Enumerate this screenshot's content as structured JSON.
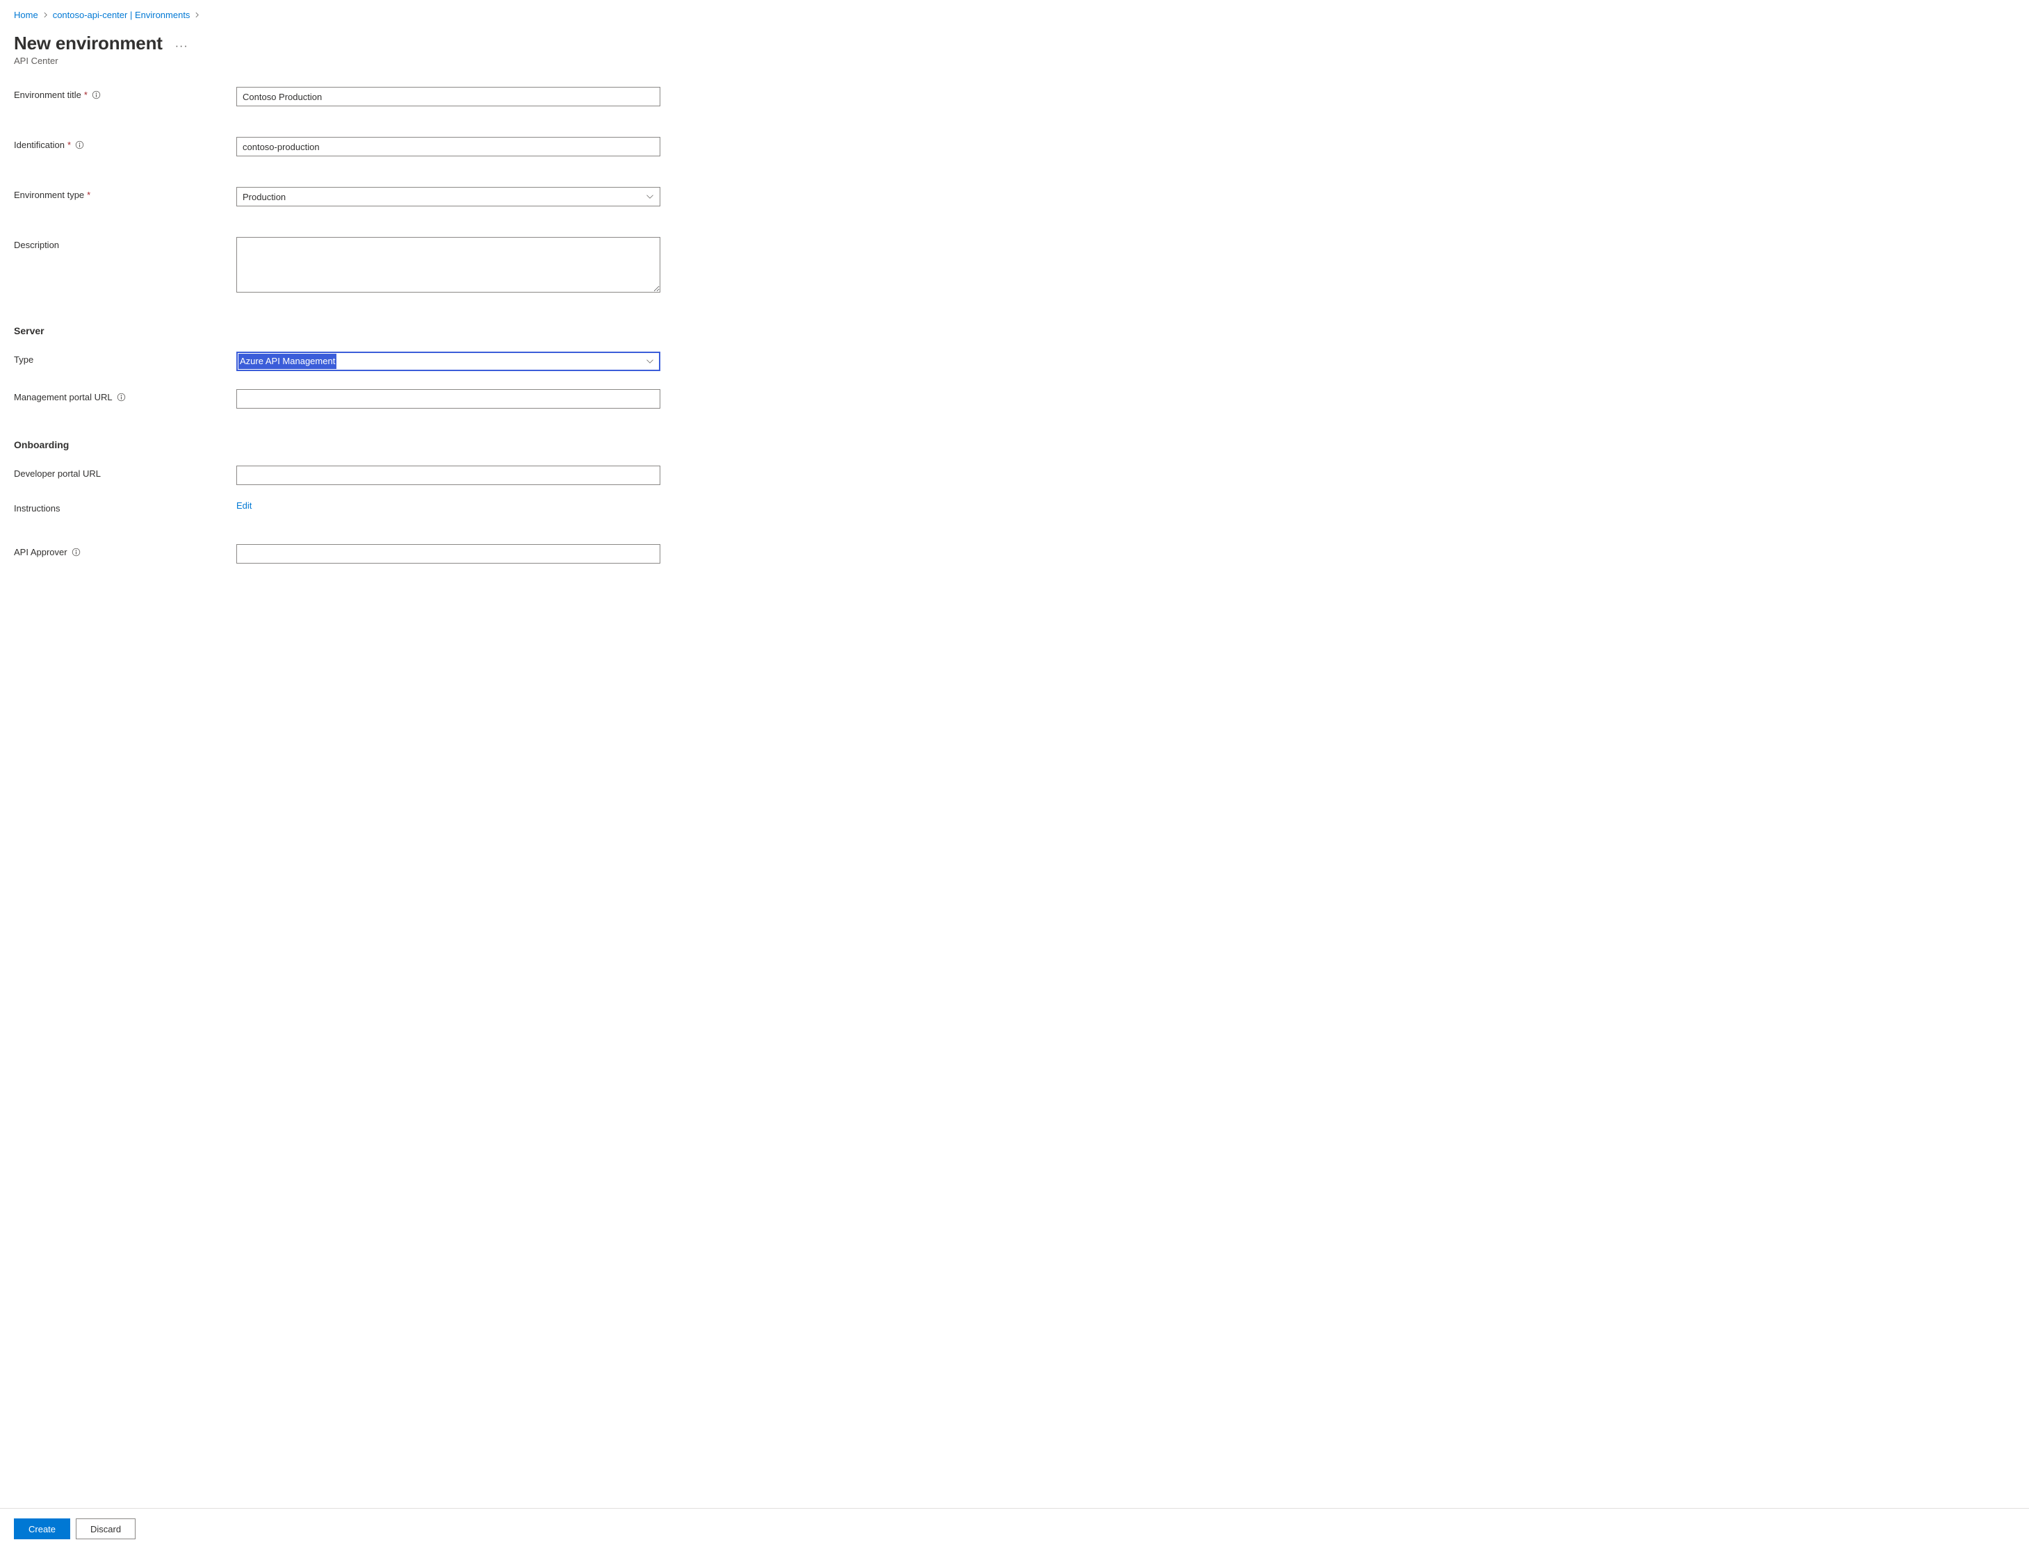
{
  "breadcrumb": {
    "home": "Home",
    "resource": "contoso-api-center | Environments"
  },
  "header": {
    "title": "New environment",
    "subtitle": "API Center"
  },
  "fields": {
    "env_title": {
      "label": "Environment title",
      "value": "Contoso Production"
    },
    "identification": {
      "label": "Identification",
      "value": "contoso-production"
    },
    "env_type": {
      "label": "Environment type",
      "value": "Production"
    },
    "description": {
      "label": "Description",
      "value": ""
    }
  },
  "sections": {
    "server": {
      "heading": "Server",
      "type": {
        "label": "Type",
        "value": "Azure API Management"
      },
      "mgmt_portal": {
        "label": "Management portal URL",
        "value": ""
      }
    },
    "onboarding": {
      "heading": "Onboarding",
      "dev_portal": {
        "label": "Developer portal URL",
        "value": ""
      },
      "instructions": {
        "label": "Instructions",
        "action": "Edit"
      },
      "api_approver": {
        "label": "API Approver",
        "value": ""
      }
    }
  },
  "footer": {
    "create": "Create",
    "discard": "Discard"
  }
}
